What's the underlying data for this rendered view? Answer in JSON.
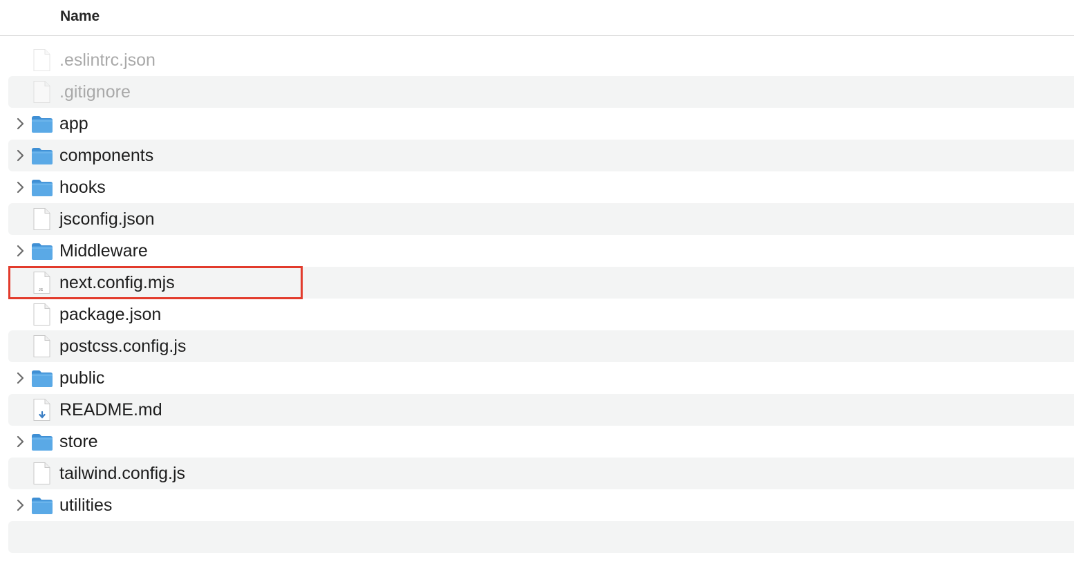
{
  "header": {
    "name_column": "Name"
  },
  "files": [
    {
      "name": ".eslintrc.json",
      "kind": "file",
      "icon": "blank-document-icon",
      "hidden": true
    },
    {
      "name": ".gitignore",
      "kind": "file",
      "icon": "blank-document-icon",
      "hidden": true
    },
    {
      "name": "app",
      "kind": "folder",
      "icon": "folder-icon"
    },
    {
      "name": "components",
      "kind": "folder",
      "icon": "folder-icon"
    },
    {
      "name": "hooks",
      "kind": "folder",
      "icon": "folder-icon"
    },
    {
      "name": "jsconfig.json",
      "kind": "file",
      "icon": "blank-document-icon"
    },
    {
      "name": "Middleware",
      "kind": "folder",
      "icon": "folder-icon"
    },
    {
      "name": "next.config.mjs",
      "kind": "file",
      "icon": "js-document-icon",
      "icon_badge": "JS",
      "highlighted": true
    },
    {
      "name": "package.json",
      "kind": "file",
      "icon": "blank-document-icon"
    },
    {
      "name": "postcss.config.js",
      "kind": "file",
      "icon": "js-document-icon"
    },
    {
      "name": "public",
      "kind": "folder",
      "icon": "folder-icon"
    },
    {
      "name": "README.md",
      "kind": "file",
      "icon": "markdown-document-icon"
    },
    {
      "name": "store",
      "kind": "folder",
      "icon": "folder-icon"
    },
    {
      "name": "tailwind.config.js",
      "kind": "file",
      "icon": "js-document-icon"
    },
    {
      "name": "utilities",
      "kind": "folder",
      "icon": "folder-icon"
    }
  ],
  "colors": {
    "folder": "#5aa9e6",
    "folder_dark": "#3f8fd4",
    "highlight_border": "#e23b2c",
    "alt_row": "#f3f4f4"
  }
}
